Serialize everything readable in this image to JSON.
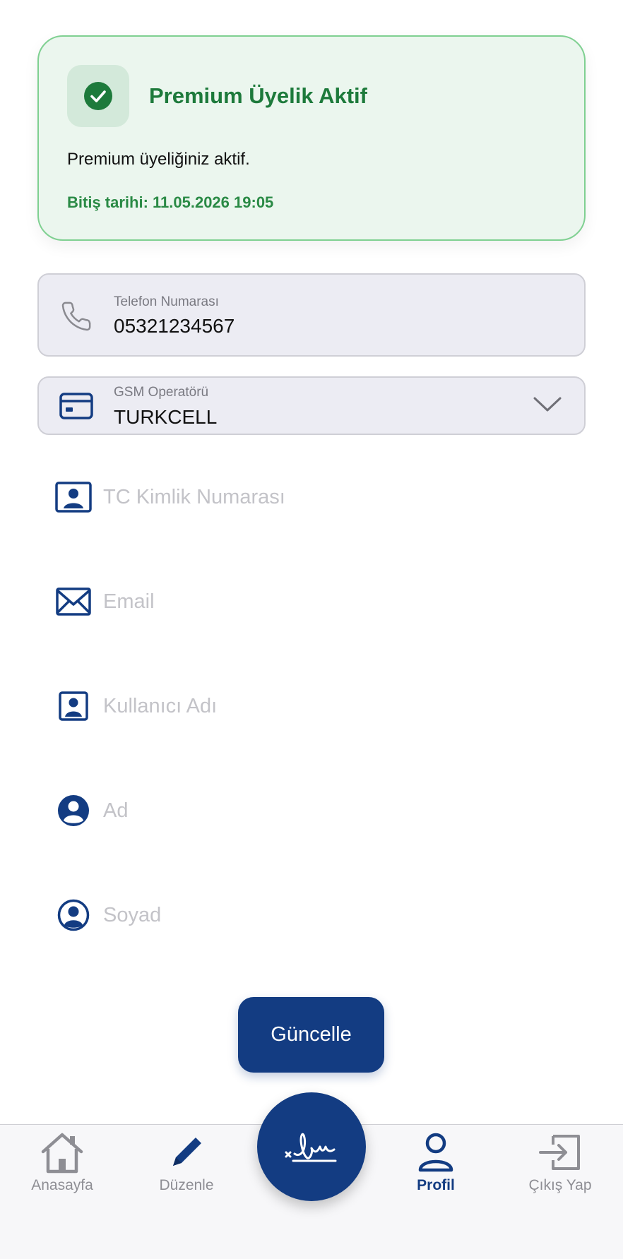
{
  "premium": {
    "title": "Premium Üyelik Aktif",
    "description": "Premium üyeliğiniz aktif.",
    "expiry": "Bitiş tarihi: 11.05.2026 19:05",
    "icon": "check-circle-icon"
  },
  "phone": {
    "label": "Telefon Numarası",
    "value": "05321234567",
    "icon": "phone-icon"
  },
  "gsm": {
    "label": "GSM Operatörü",
    "value": "TURKCELL",
    "icon": "card-icon"
  },
  "fields": {
    "tc": {
      "placeholder": "TC Kimlik Numarası",
      "icon": "id-card-icon"
    },
    "email": {
      "placeholder": "Email",
      "icon": "envelope-icon"
    },
    "username": {
      "placeholder": "Kullanıcı Adı",
      "icon": "user-badge-icon"
    },
    "first_name": {
      "placeholder": "Ad",
      "icon": "user-circle-filled-icon"
    },
    "last_name": {
      "placeholder": "Soyad",
      "icon": "user-circle-outline-icon"
    }
  },
  "update_button": "Güncelle",
  "nav": {
    "home": "Anasayfa",
    "edit": "Düzenle",
    "center": "signature-icon",
    "profile": "Profil",
    "logout": "Çıkış Yap",
    "active": "profile"
  },
  "colors": {
    "primary": "#133c82",
    "success": "#1d7a3b",
    "success_bg": "#ebf6ee",
    "placeholder": "#c3c3c8"
  }
}
